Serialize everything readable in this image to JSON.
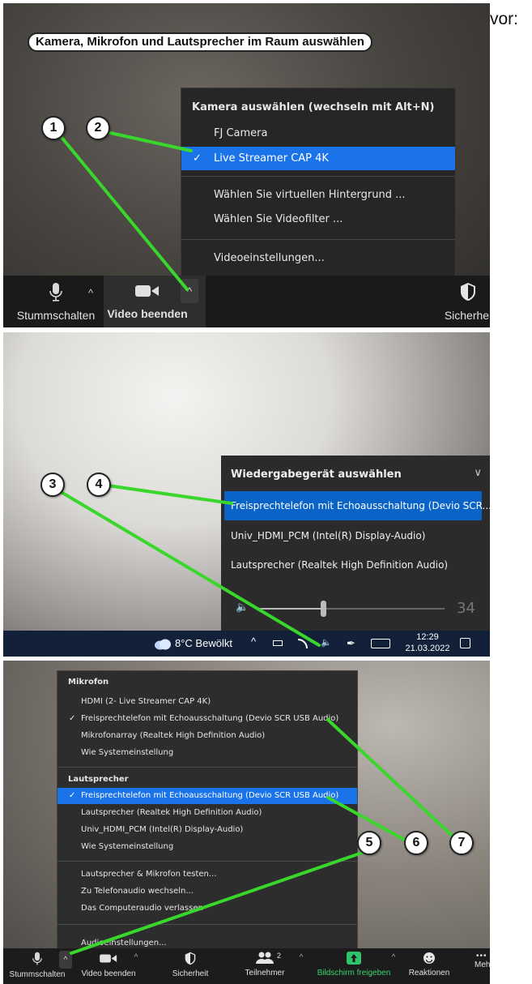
{
  "header": {
    "caption": "Kamera, Mikrofon und Lautsprecher im Raum auswählen",
    "trailing_text": "vor:"
  },
  "callouts": [
    "1",
    "2",
    "3",
    "4",
    "5",
    "6",
    "7"
  ],
  "colors": {
    "accent": "#1a73e8",
    "arrow": "#39d62c",
    "menu_bg": "#262626",
    "taskbar": "#12203a"
  },
  "camera_menu": {
    "title": "Kamera auswählen (wechseln mit Alt+N)",
    "items": [
      "FJ Camera",
      "Live Streamer CAP 4K"
    ],
    "selected_index": 1,
    "check_mark": "✓",
    "actions": [
      "Wählen Sie virtuellen Hintergrund ...",
      "Wählen Sie Videofilter ..."
    ],
    "settings": "Videoeinstellungen..."
  },
  "toolbar1": {
    "mute_label": "Stummschalten",
    "video_label": "Video beenden",
    "security_label": "Sicherhei",
    "caret": "^"
  },
  "playback_menu": {
    "title": "Wiedergabegerät auswählen",
    "chevron": "∨",
    "items": [
      "Freisprechtelefon mit Echoausschaltung (Devio SCR...",
      "Univ_HDMI_PCM (Intel(R) Display-Audio)",
      "Lautsprecher (Realtek High Definition Audio)"
    ],
    "selected_index": 0,
    "volume": 34,
    "volume_icon": "speaker-icon"
  },
  "taskbar": {
    "weather": "8°C Bewölkt",
    "time": "12:29",
    "date": "21.03.2022",
    "icons": [
      "cloud-icon",
      "chevron-up-icon",
      "battery-icon",
      "wifi-icon",
      "speaker-icon",
      "pen-icon",
      "keyboard-icon",
      "notification-icon"
    ]
  },
  "audio_menu": {
    "mic_header": "Mikrofon",
    "mic_items": [
      "HDMI (2- Live Streamer CAP 4K)",
      "Freisprechtelefon mit Echoausschaltung (Devio SCR USB Audio)",
      "Mikrofonarray (Realtek High Definition Audio)",
      "Wie Systemeinstellung"
    ],
    "mic_selected_index": 1,
    "speaker_header": "Lautsprecher",
    "speaker_items": [
      "Freisprechtelefon mit Echoausschaltung (Devio SCR USB Audio)",
      "Lautsprecher (Realtek High Definition Audio)",
      "Univ_HDMI_PCM (Intel(R) Display-Audio)",
      "Wie Systemeinstellung"
    ],
    "speaker_selected_index": 0,
    "actions": [
      "Lautsprecher & Mikrofon testen...",
      "Zu Telefonaudio wechseln...",
      "Das Computeraudio verlassen"
    ],
    "settings": "Audioeinstellungen..."
  },
  "toolbar3": {
    "mute_label": "Stummschalten",
    "video_label": "Video beenden",
    "security_label": "Sicherheit",
    "participants_label": "Teilnehmer",
    "participants_count": "2",
    "share_label": "Bildschirm freigeben",
    "reactions_label": "Reaktionen",
    "more_label": "Meh",
    "more_glyph": "•••"
  }
}
